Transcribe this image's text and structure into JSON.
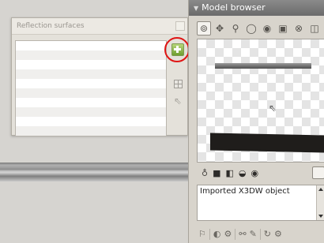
{
  "dialog": {
    "title": "Reflection surfaces",
    "row_count": 10,
    "icons": {
      "add": "add-icon",
      "grid": "grid-icon",
      "pointer": "pointer-icon",
      "close": "close-icon"
    }
  },
  "panel": {
    "title": "Model browser",
    "toolbar_icons": [
      "select-icon",
      "move-icon",
      "search-icon",
      "sphere-icon",
      "target-icon",
      "plane-icon",
      "link-icon",
      "export-icon"
    ],
    "bottom_tool_icons": [
      "bulb-icon",
      "cube-icon",
      "lock-icon",
      "light-icon",
      "eye-icon",
      "frame-icon"
    ],
    "info_text": "Imported X3DW object",
    "bottom_bar_icons": [
      "flag-icon",
      "contrast-icon",
      "gear-icon",
      "link-icon",
      "brush-icon",
      "refresh-icon",
      "settings-icon"
    ]
  },
  "colors": {
    "highlight_ring": "#e01414",
    "add_green": "#6e9d2f"
  }
}
